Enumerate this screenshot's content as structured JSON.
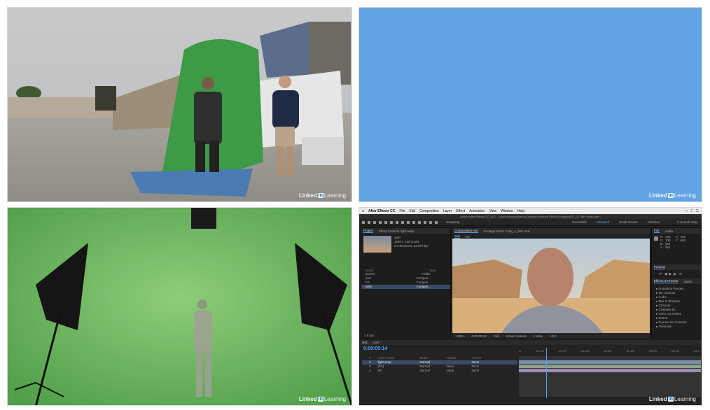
{
  "watermark": {
    "brand": "Linked",
    "in": "in",
    "suffix": "Learning"
  },
  "ae": {
    "app_name": "After Effects CC",
    "menu": [
      "File",
      "Edit",
      "Composition",
      "Layer",
      "Effect",
      "Animation",
      "View",
      "Window",
      "Help"
    ],
    "window_title": "Adobe After Effects CC 2017 - /Users/alandoshamoo/Desktop/Exercise Files/03.mapping/03_03 Light Wrap.aep *",
    "tools": {
      "snapping": "Snapping"
    },
    "workspaces": [
      "Essentials",
      "Standard",
      "Small Screen",
      "Libraries"
    ],
    "active_workspace": "Standard",
    "search_placeholder": "Search Help",
    "project_tabs": [
      "Project",
      "Effect Controls light wrap"
    ],
    "project_item": {
      "name": "start",
      "dims": "1280 x 720 (1.00)",
      "duration": "Δ 0:00:04:01, 23.976 fps"
    },
    "project_columns": [
      "Name",
      "Type"
    ],
    "project_rows": [
      {
        "name": "assets",
        "type": "Folder"
      },
      {
        "name": "end",
        "type": "Compos..."
      },
      {
        "name": "FG",
        "type": "Compos..."
      },
      {
        "name": "start",
        "type": "Compos..."
      }
    ],
    "project_footer": "8 bpc",
    "viewer_tabs": [
      "Composition end",
      "Footage Stock Cops_A_091.mov"
    ],
    "viewer_subtabs": [
      "end",
      "FG"
    ],
    "viewer_footer": {
      "zoom": "100%",
      "timecode": "0:00:00:14",
      "res": "Full",
      "camera": "Active Camera",
      "views": "1 View",
      "exposure": "+0.0"
    },
    "info": {
      "tabs": [
        "Info",
        "Audio"
      ],
      "values": [
        "R : 146",
        "G : 138",
        "B : 149",
        "A : 255"
      ],
      "coords": [
        "X : 435",
        "Y : 606"
      ]
    },
    "preview_label": "Preview",
    "effects_tabs": [
      "Effects & Presets",
      "Librar"
    ],
    "effects_list": [
      "Animation Presets",
      "3D Channel",
      "Audio",
      "Blur & Sharpen",
      "Channel",
      "CINEMA 4D",
      "Color Correction",
      "Distort",
      "Expression Controls",
      "Generate"
    ],
    "timeline_tabs": [
      "end",
      "start"
    ],
    "timeline_tc": "0:00:00:14",
    "ruler": [
      "0f",
      "00:12f",
      "01:00f",
      "01:12f",
      "02:00f",
      "02:12f",
      "03:00f",
      "03:12f",
      "04:0"
    ],
    "layer_header": [
      "#",
      "Layer Name",
      "Mode",
      "TrkMat",
      "Parent"
    ],
    "layers": [
      {
        "num": "1",
        "name": "light wrap",
        "mode": "Normal",
        "trkmat": "",
        "parent": "None"
      },
      {
        "num": "2",
        "name": "[FG]",
        "mode": "Normal",
        "trkmat": "None",
        "parent": "None"
      },
      {
        "num": "3",
        "name": "BG",
        "mode": "Normal",
        "trkmat": "None",
        "parent": "None"
      }
    ]
  }
}
